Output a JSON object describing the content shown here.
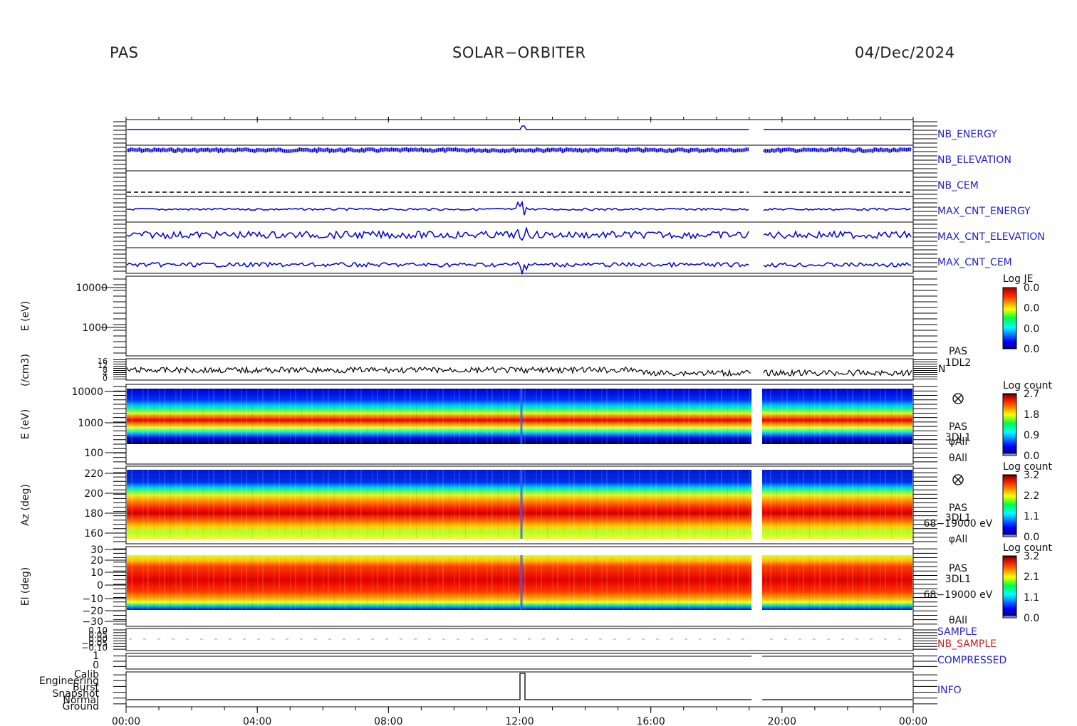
{
  "header": {
    "left": "PAS",
    "center": "SOLAR−ORBITER",
    "right": "04/Dec/2024"
  },
  "colors": {
    "label_blue": "#2222cc",
    "label_red": "#cc2222",
    "trace_blue": "#0000dd",
    "trace_black": "#000000"
  },
  "chart_data": {
    "type": "heatmap",
    "x_ticks": [
      "00:00",
      "04:00",
      "08:00",
      "12:00",
      "16:00",
      "20:00",
      "00:00"
    ],
    "data_gap": [
      "19:10",
      "19:35"
    ],
    "trace_panels": [
      {
        "label": "NB_ENERGY",
        "color": "blue"
      },
      {
        "label": "NB_ELEVATION",
        "color": "blue"
      },
      {
        "label": "NB_CEM",
        "color": "blue"
      },
      {
        "label": "MAX_CNT_ENERGY",
        "color": "blue"
      },
      {
        "label": "MAX_CNT_ELEVATION",
        "color": "blue"
      },
      {
        "label": "MAX_CNT_CEM",
        "color": "blue"
      }
    ],
    "energy_panel": {
      "ylabel": "E (eV)",
      "yticks": [
        "10000",
        "1000"
      ],
      "colorbar_title": "Log JE",
      "colorbar_ticks": [
        "0.0",
        "0.0",
        "0.0",
        "0.0"
      ]
    },
    "density_panel": {
      "ylabel": "(/cm3)",
      "yticks": [
        "16",
        "12",
        "8",
        "4",
        "0"
      ],
      "right_labels": [
        "PAS",
        "1DL2",
        "N"
      ]
    },
    "spectrogram_panels": [
      {
        "ylabel": "E (eV)",
        "yticks": [
          "10000",
          "1000",
          "100"
        ],
        "colorbar_title": "Log count",
        "colorbar_ticks": [
          "2.7",
          "1.8",
          "0.9",
          "0.0"
        ],
        "right_labels": [
          "PAS",
          "3DL1",
          "φAll",
          "θAll"
        ]
      },
      {
        "ylabel": "Az (deg)",
        "yticks": [
          "220",
          "200",
          "180",
          "160"
        ],
        "colorbar_title": "Log count",
        "colorbar_ticks": [
          "3.2",
          "2.2",
          "1.1",
          "0.0"
        ],
        "right_labels": [
          "PAS",
          "3DL1",
          "68−19000 eV",
          "φAll"
        ]
      },
      {
        "ylabel": "El (deg)",
        "yticks": [
          "30",
          "20",
          "10",
          "0",
          "−10",
          "−20",
          "−30"
        ],
        "colorbar_title": "Log count",
        "colorbar_ticks": [
          "3.2",
          "2.1",
          "1.1",
          "0.0"
        ],
        "right_labels": [
          "PAS",
          "3DL1",
          "68−19000 eV",
          "θAll"
        ]
      }
    ],
    "sample_panel": {
      "yticks": [
        "0.10",
        "0.05",
        "0.00",
        "−0.05",
        "−0.10"
      ],
      "labels": [
        {
          "text": "SAMPLE",
          "color": "blue"
        },
        {
          "text": "NB_SAMPLE",
          "color": "red"
        }
      ]
    },
    "compressed_panel": {
      "yticks": [
        "1",
        "0"
      ],
      "label": "COMPRESSED"
    },
    "info_panel": {
      "states": [
        "Calib",
        "Engineering",
        "Burst",
        "Snapshot",
        "Normal",
        "Ground"
      ],
      "label": "INFO"
    }
  }
}
